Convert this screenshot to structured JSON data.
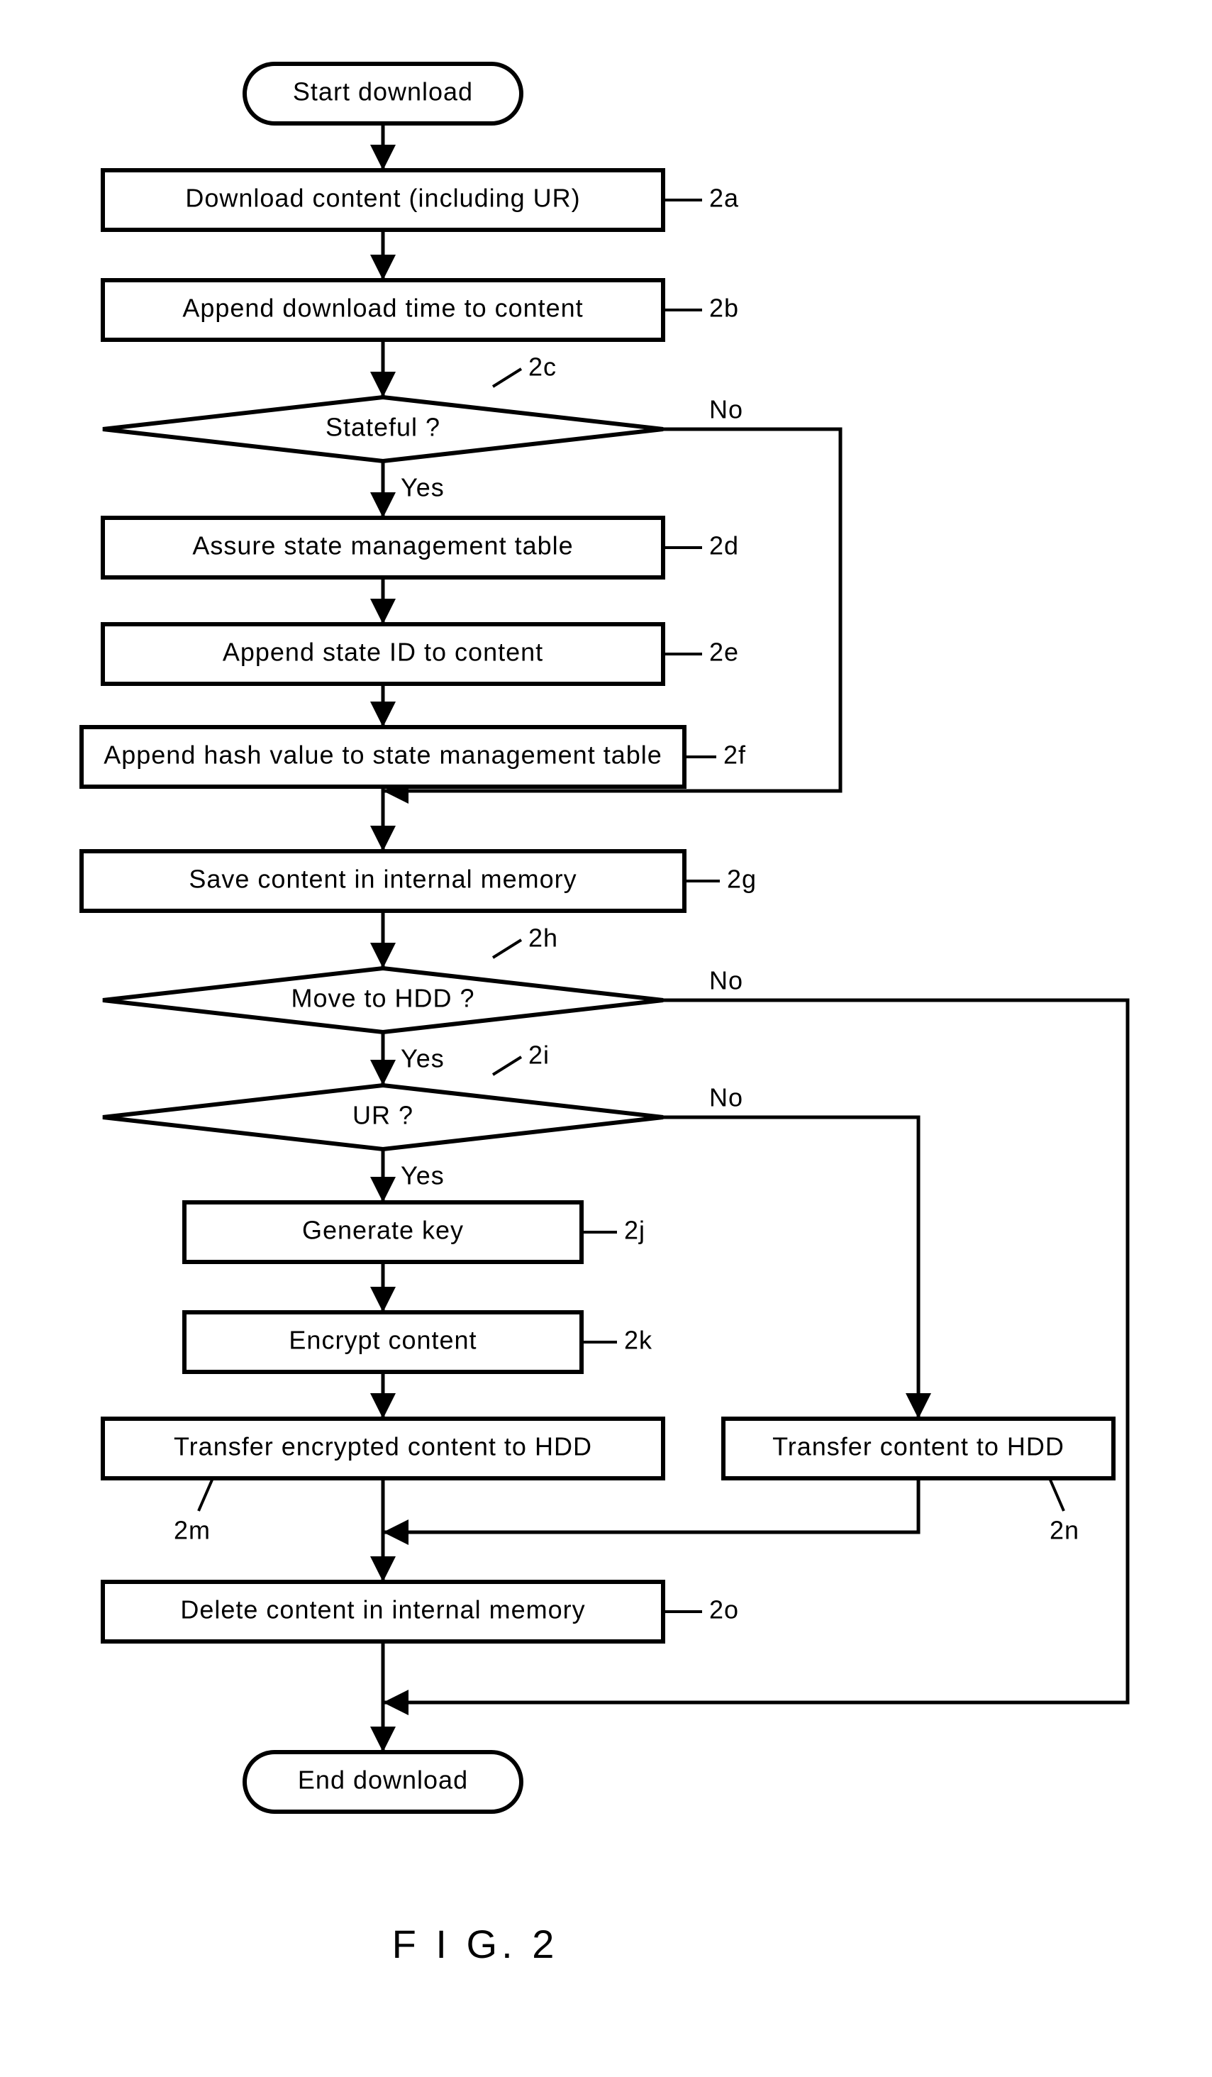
{
  "terminator_start": "Start download",
  "terminator_end": "End download",
  "steps": {
    "a": {
      "text": "Download content (including UR)",
      "label": "2a"
    },
    "b": {
      "text": "Append download time to content",
      "label": "2b"
    },
    "c": {
      "text": "Stateful ?",
      "label": "2c",
      "yes": "Yes",
      "no": "No"
    },
    "d": {
      "text": "Assure state management table",
      "label": "2d"
    },
    "e": {
      "text": "Append state ID to content",
      "label": "2e"
    },
    "f": {
      "text": "Append hash value to state management table",
      "label": "2f"
    },
    "g": {
      "text": "Save content in internal memory",
      "label": "2g"
    },
    "h": {
      "text": "Move to HDD ?",
      "label": "2h",
      "yes": "Yes",
      "no": "No"
    },
    "i": {
      "text": "UR ?",
      "label": "2i",
      "yes": "Yes",
      "no": "No"
    },
    "j": {
      "text": "Generate key",
      "label": "2j"
    },
    "k": {
      "text": "Encrypt content",
      "label": "2k"
    },
    "m": {
      "text": "Transfer encrypted content to HDD",
      "label": "2m"
    },
    "n": {
      "text": "Transfer content to HDD",
      "label": "2n"
    },
    "o": {
      "text": "Delete content in internal memory",
      "label": "2o"
    }
  },
  "figure": "F I G. 2"
}
